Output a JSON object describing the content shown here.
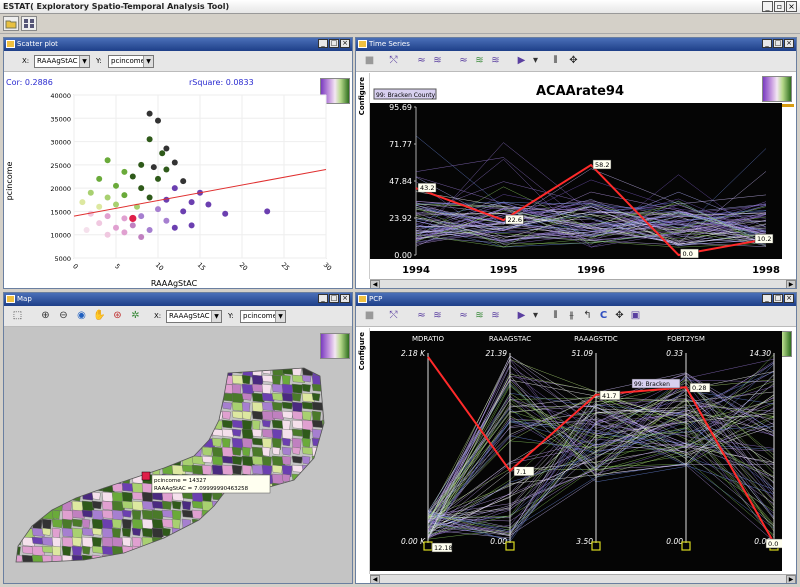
{
  "app": {
    "title": "ESTAT( Exploratory Spatio-Temporal Analysis Tool)"
  },
  "scatter": {
    "title": "Scatter plot",
    "x_label": "X:",
    "x_value": "RAAAgStAC",
    "y_label": "Y:",
    "y_value": "pcincome",
    "cor": "Cor: 0.2886",
    "rsquare": "rSquare: 0.0833",
    "xaxis_title": "RAAAgStAC",
    "yaxis_title": "pcincome"
  },
  "timeseries": {
    "title": "Time Series",
    "configure": "Configure",
    "tag": "99: Bracken County",
    "chart_title": "ACAArate94",
    "value_labels": [
      "43.2",
      "22.6",
      "58.2",
      "0.0",
      "10.2"
    ]
  },
  "map": {
    "title": "Map",
    "x_label": "X:",
    "x_value": "RAAAgStAC",
    "y_label": "Y:",
    "y_value": "pcincome",
    "tooltip_line1": "pcincome = 14327",
    "tooltip_line2": "RAAAgStAC = 7.09999990463258"
  },
  "pcp": {
    "title": "PCP",
    "configure": "Configure",
    "axes": [
      "MDRATIO",
      "RAAAGSTAC",
      "RAAAGSTDC",
      "FOBT2YSM",
      ""
    ],
    "tops": [
      "2.18 K",
      "21.39",
      "51.09",
      "0.33",
      "14.30"
    ],
    "bottoms": [
      "0.00 K",
      "0.00",
      "3.50",
      "0.00",
      "0.00"
    ],
    "tag": "99: Bracken",
    "value_labels": [
      "12.18",
      "7.1",
      "41.7",
      "0.28",
      "0.0"
    ]
  },
  "chart_data": [
    {
      "type": "scatter",
      "title": "",
      "xlabel": "RAAAgStAC",
      "ylabel": "pcincome",
      "xlim": [
        0,
        30
      ],
      "ylim": [
        5000,
        40000
      ],
      "x_ticks": [
        "0",
        "5",
        "10",
        "15",
        "20",
        "25",
        "30"
      ],
      "y_ticks": [
        "5000",
        "10000",
        "15000",
        "20000",
        "25000",
        "30000",
        "35000",
        "40000"
      ],
      "annotations": [
        "Cor: 0.2886",
        "rSquare: 0.0833"
      ],
      "regression_line": {
        "x": [
          0,
          30
        ],
        "y": [
          14000,
          24000
        ]
      },
      "points": [
        {
          "x": 9,
          "y": 36000,
          "c": "#333333"
        },
        {
          "x": 10,
          "y": 34500,
          "c": "#333333"
        },
        {
          "x": 11,
          "y": 28500,
          "c": "#333333"
        },
        {
          "x": 10.5,
          "y": 27500,
          "c": "#2f5a1a"
        },
        {
          "x": 9,
          "y": 30500,
          "c": "#2f5a1a"
        },
        {
          "x": 12,
          "y": 25500,
          "c": "#333333"
        },
        {
          "x": 8,
          "y": 25000,
          "c": "#2f5a1a"
        },
        {
          "x": 9.5,
          "y": 24500,
          "c": "#333333"
        },
        {
          "x": 11,
          "y": 24000,
          "c": "#2f5a1a"
        },
        {
          "x": 4,
          "y": 26000,
          "c": "#6aaa3a"
        },
        {
          "x": 6,
          "y": 23500,
          "c": "#6aaa3a"
        },
        {
          "x": 3,
          "y": 22000,
          "c": "#6aaa3a"
        },
        {
          "x": 7,
          "y": 22500,
          "c": "#2f5a1a"
        },
        {
          "x": 10,
          "y": 22000,
          "c": "#2f5a1a"
        },
        {
          "x": 13,
          "y": 21500,
          "c": "#333333"
        },
        {
          "x": 5,
          "y": 20500,
          "c": "#6aaa3a"
        },
        {
          "x": 8,
          "y": 20000,
          "c": "#2f5a1a"
        },
        {
          "x": 12,
          "y": 20000,
          "c": "#6b3fb0"
        },
        {
          "x": 15,
          "y": 19000,
          "c": "#6b3fb0"
        },
        {
          "x": 2,
          "y": 19000,
          "c": "#a8d070"
        },
        {
          "x": 4,
          "y": 18000,
          "c": "#a8d070"
        },
        {
          "x": 6,
          "y": 18500,
          "c": "#6aaa3a"
        },
        {
          "x": 9,
          "y": 18000,
          "c": "#2f5a1a"
        },
        {
          "x": 11,
          "y": 17500,
          "c": "#6b3fb0"
        },
        {
          "x": 14,
          "y": 17000,
          "c": "#6b3fb0"
        },
        {
          "x": 16,
          "y": 16500,
          "c": "#6b3fb0"
        },
        {
          "x": 1,
          "y": 17000,
          "c": "#dde8a0"
        },
        {
          "x": 3,
          "y": 16000,
          "c": "#dde8a0"
        },
        {
          "x": 5,
          "y": 16500,
          "c": "#a8d070"
        },
        {
          "x": 7.5,
          "y": 16000,
          "c": "#a8d070"
        },
        {
          "x": 10,
          "y": 15500,
          "c": "#a67fd0"
        },
        {
          "x": 13,
          "y": 15000,
          "c": "#6b3fb0"
        },
        {
          "x": 18,
          "y": 14500,
          "c": "#6b3fb0"
        },
        {
          "x": 2,
          "y": 14500,
          "c": "#f0c8e0"
        },
        {
          "x": 4,
          "y": 14000,
          "c": "#e0a0d0"
        },
        {
          "x": 6,
          "y": 13500,
          "c": "#e0a0d0"
        },
        {
          "x": 8,
          "y": 14000,
          "c": "#a67fd0"
        },
        {
          "x": 11,
          "y": 13000,
          "c": "#a67fd0"
        },
        {
          "x": 14,
          "y": 12000,
          "c": "#6b3fb0"
        },
        {
          "x": 3,
          "y": 12500,
          "c": "#f0c8e0"
        },
        {
          "x": 5,
          "y": 11500,
          "c": "#e0a0d0"
        },
        {
          "x": 7,
          "y": 12000,
          "c": "#c080c0"
        },
        {
          "x": 9,
          "y": 11000,
          "c": "#a67fd0"
        },
        {
          "x": 1.5,
          "y": 11000,
          "c": "#f5e0ec"
        },
        {
          "x": 4,
          "y": 10000,
          "c": "#f0c8e0"
        },
        {
          "x": 6,
          "y": 10500,
          "c": "#e0a0d0"
        },
        {
          "x": 8,
          "y": 9500,
          "c": "#c080c0"
        },
        {
          "x": 12,
          "y": 11500,
          "c": "#6b3fb0"
        },
        {
          "x": 23,
          "y": 15000,
          "c": "#6b3fb0"
        },
        {
          "x": 7,
          "y": 13500,
          "c": "#e0204a"
        }
      ]
    },
    {
      "type": "line",
      "title": "ACAArate94",
      "x": [
        1994,
        1995,
        1996,
        1997,
        1998
      ],
      "x_ticks": [
        "1994",
        "1995",
        "1996",
        "1998"
      ],
      "y_ticks": [
        "0.00",
        "23.92",
        "47.84",
        "71.77",
        "95.69"
      ],
      "ylim": [
        0,
        95.69
      ],
      "series": [
        {
          "name": "99: Bracken County",
          "values": [
            43.2,
            22.6,
            58.2,
            0.0,
            10.2
          ]
        }
      ]
    },
    {
      "type": "line",
      "title": "",
      "categories": [
        "MDRATIO",
        "RAAAGSTAC",
        "RAAAGSTDC",
        "FOBT2YSM",
        ""
      ],
      "series": [
        {
          "name": "99: Bracken",
          "values": [
            12.18,
            7.1,
            41.7,
            0.28,
            0.0
          ]
        }
      ]
    }
  ]
}
